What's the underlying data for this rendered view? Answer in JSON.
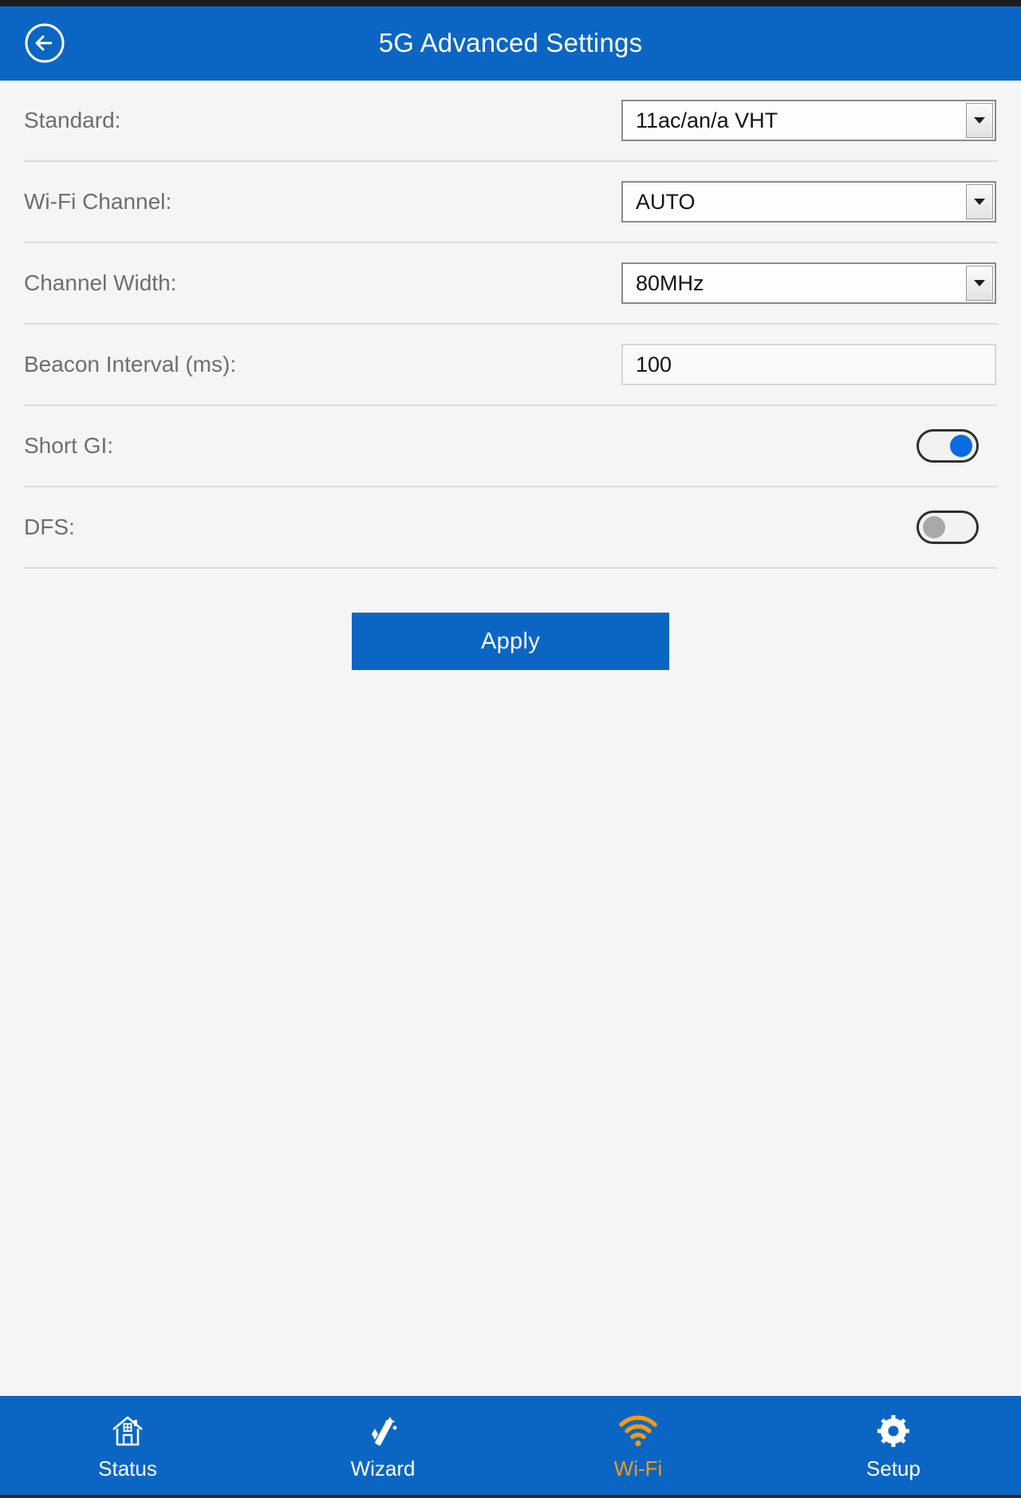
{
  "header": {
    "title": "5G Advanced Settings",
    "back_icon": "back-arrow-circle-icon",
    "bg_color": "#0B66C3"
  },
  "form": {
    "rows": [
      {
        "label": "Standard:",
        "type": "select",
        "value": "11ac/an/a VHT"
      },
      {
        "label": "Wi-Fi Channel:",
        "type": "select",
        "value": "AUTO"
      },
      {
        "label": "Channel Width:",
        "type": "select",
        "value": "80MHz"
      },
      {
        "label": "Beacon Interval (ms):",
        "type": "text",
        "value": "100",
        "placeholder": ""
      },
      {
        "label": "Short GI:",
        "type": "toggle",
        "value": "on"
      },
      {
        "label": "DFS:",
        "type": "toggle",
        "value": "off"
      }
    ]
  },
  "actions": {
    "apply_label": "Apply",
    "apply_color": "#0B66C3"
  },
  "bottom_nav": {
    "active_color": "#F59A11",
    "items": [
      {
        "label": "Status",
        "icon": "home-icon",
        "active": false
      },
      {
        "label": "Wizard",
        "icon": "wand-icon",
        "active": false
      },
      {
        "label": "Wi-Fi",
        "icon": "wifi-icon",
        "active": true
      },
      {
        "label": "Setup",
        "icon": "gear-icon",
        "active": false
      }
    ]
  }
}
